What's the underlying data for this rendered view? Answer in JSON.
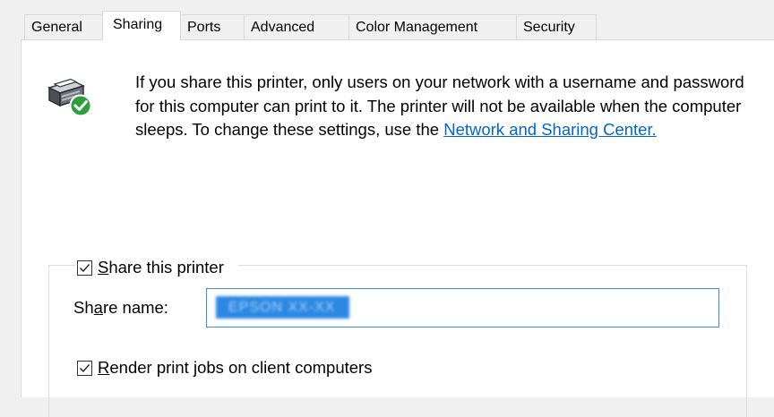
{
  "tabs": [
    {
      "label": "General"
    },
    {
      "label": "Sharing"
    },
    {
      "label": "Ports"
    },
    {
      "label": "Advanced"
    },
    {
      "label": "Color Management"
    },
    {
      "label": "Security"
    }
  ],
  "active_tab": "Sharing",
  "info": {
    "text": "If you share this printer, only users on your network with a username and password for this computer can print to it. The printer will not be available when the computer sleeps. To change these settings, use the ",
    "link_label": "Network and Sharing Center.",
    "icon": "shared-printer-icon"
  },
  "share_printer": {
    "label_mnemonic": "S",
    "label_rest": "hare this printer",
    "checked": true
  },
  "share_name": {
    "label_pre": "Sh",
    "label_mnemonic": "a",
    "label_post": "re name:",
    "value": "EPSON XX-XX"
  },
  "render_jobs": {
    "label_mnemonic": "R",
    "label_rest": "ender print jobs on client computers",
    "checked": true
  },
  "colors": {
    "link": "#0066cc",
    "selection": "#2b88e3",
    "focus_border": "#3c8fd6",
    "check_badge": "#2e9e3e"
  }
}
